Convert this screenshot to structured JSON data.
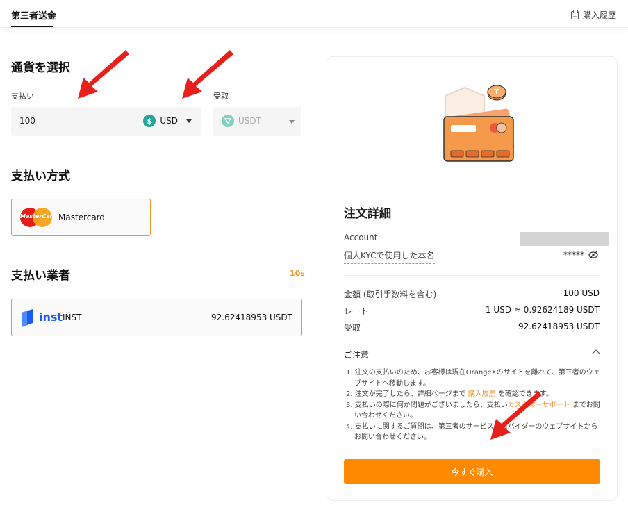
{
  "header": {
    "tab_label": "第三者送金",
    "history_label": "購入履歴"
  },
  "currency": {
    "title": "通貨を選択",
    "pay_label": "支払い",
    "pay_value": "100",
    "pay_currency": "USD",
    "receive_label": "受取",
    "receive_currency": "USDT"
  },
  "payment_method": {
    "title": "支払い方式",
    "selected": "Mastercard",
    "logo_text": "MasterCard"
  },
  "provider": {
    "title": "支払い業者",
    "timer": "10s",
    "brand_word": "inst",
    "name": "INST",
    "amount": "92.62418953 USDT"
  },
  "order": {
    "title": "注文詳細",
    "account_label": "Account",
    "kyc_label": "個人KYCで使用した本名",
    "kyc_masked": "*****",
    "amount_label": "金額 (取引手数料を含む)",
    "amount_value": "100 USD",
    "rate_label": "レート",
    "rate_value": "1 USD ≈ 0.92624189 USDT",
    "receive_label": "受取",
    "receive_value": "92.62418953 USDT",
    "notice_title": "ご注意",
    "notes": {
      "n1": "1. 注文の支払いのため、お客様は現在OrangeXのサイトを離れて、第三者のウェブサイトへ移動します。",
      "n2_pre": "2. 注文が完了したら、詳細ページまで ",
      "n2_link": "購入履歴",
      "n2_post": " を確認できます。",
      "n3_pre": "3. 支払いの際に何か問題がございましたら、支払い",
      "n3_link": "カスタマーサポート",
      "n3_post": " までお問い合わせください。",
      "n4": "4. 支払いに関するご質問は、第三者のサービスプロバイダーのウェブサイトからお問い合わせください。"
    },
    "buy_button": "今すぐ購入"
  },
  "colors": {
    "accent": "#f0952d",
    "button": "#ff8a00",
    "annotation_arrow": "#e8201c"
  }
}
